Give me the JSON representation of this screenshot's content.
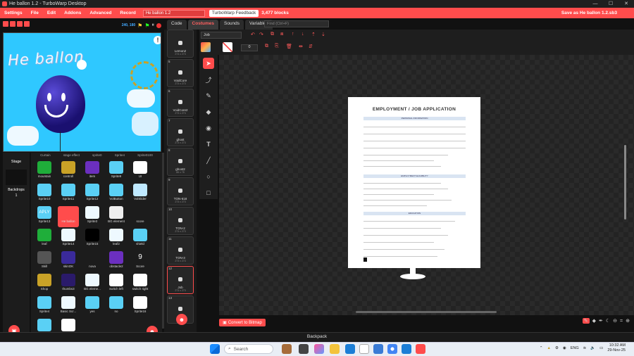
{
  "window": {
    "title": "He ballon 1.2 - TurboWarp Desktop",
    "min": "—",
    "max": "☐",
    "close": "✕"
  },
  "menu": {
    "items": [
      "Settings",
      "File",
      "Edit",
      "Addons",
      "Advanced",
      "Record"
    ],
    "project_title": "He ballon 1.2",
    "feedback": "TurboWarp Feedback",
    "block_count": "3,477 blocks",
    "save_as": "Save as He ballon 1.2.sb3"
  },
  "stage": {
    "fps": "240, 180",
    "canvas_text": "He ballon",
    "pane_label": "Stage",
    "backdrops_label": "Backdrops",
    "backdrops_count": "1"
  },
  "sprites": {
    "cut_row": [
      "Curtain",
      "stage effect",
      "sprite0",
      "Sprite4",
      "Sprite0100"
    ],
    "items": [
      {
        "name": "mountain",
        "color": "#1fae3a"
      },
      {
        "name": "controll",
        "color": "#c9a227"
      },
      {
        "name": "item",
        "color": "#6b2fbf"
      },
      {
        "name": "Sprite9",
        "color": "#5ad0f5"
      },
      {
        "name": "UI",
        "color": "#ffffff"
      },
      {
        "name": "Sprite10",
        "color": "#5ad0f5"
      },
      {
        "name": "Sprite11",
        "color": "#5ad0f5"
      },
      {
        "name": "Sprite12",
        "color": "#5ad0f5"
      },
      {
        "name": "VolButton",
        "color": "#5ad0f5"
      },
      {
        "name": "VolSlider",
        "color": "#bfe9ff"
      },
      {
        "name": "Sprite13",
        "color": "#5ad0f5",
        "badge": "APLY"
      },
      {
        "name": "He ballon",
        "color": "#ff4c4c"
      },
      {
        "name": "Sprite3",
        "color": "#eef9ff"
      },
      {
        "name": "BG element",
        "color": "#eeeeee"
      },
      {
        "name": "score",
        "color": "#1c1c1c"
      },
      {
        "name": "leaf",
        "color": "#1fae3a"
      },
      {
        "name": "Sprite14",
        "color": "#eef9ff"
      },
      {
        "name": "Sprite15",
        "color": "#000000"
      },
      {
        "name": "leaf2",
        "color": "#eef9ff"
      },
      {
        "name": "shield",
        "color": "#5ad0f5"
      },
      {
        "name": "Skill",
        "color": "#555555"
      },
      {
        "name": "skinOK",
        "color": "#3a2a9a"
      },
      {
        "name": "nova",
        "color": "#1c1c1c"
      },
      {
        "name": "obstacle2",
        "color": "#6b2fbf"
      },
      {
        "name": "Score",
        "color": "#1c1c1c",
        "glyph": "9"
      },
      {
        "name": "Shop",
        "color": "#c9a227"
      },
      {
        "name": "thumbs3",
        "color": "#2a1a6a"
      },
      {
        "name": "BG eleme...",
        "color": "#eef9ff"
      },
      {
        "name": "switch left",
        "color": "#ffffff"
      },
      {
        "name": "switch right",
        "color": "#ffffff"
      },
      {
        "name": "Sprite4",
        "color": "#5ad0f5"
      },
      {
        "name": "Basic Scr...",
        "color": "#eef9ff"
      },
      {
        "name": "yes",
        "color": "#5ad0f5"
      },
      {
        "name": "no",
        "color": "#5ad0f5"
      },
      {
        "name": "Sprite16",
        "color": "#ffffff"
      },
      {
        "name": "ok",
        "color": "#5ad0f5"
      },
      {
        "name": "shop lay",
        "color": "#ffffff"
      }
    ]
  },
  "editor": {
    "tabs": [
      "Code",
      "Costumes",
      "Sounds",
      "Variables"
    ],
    "find_placeholder": "Find (Ctrl+F)",
    "costume_name": "Job",
    "size_value": "0",
    "convert_label": "Convert to Bitmap",
    "backpack_label": "Backpack"
  },
  "costumes": [
    {
      "num": "",
      "name": "Lemon2",
      "size": "273 x 273"
    },
    {
      "num": "5",
      "name": "VoidCore",
      "size": "273 x 273"
    },
    {
      "num": "6",
      "name": "VoidCore2",
      "size": "273 x 273"
    },
    {
      "num": "7",
      "name": "ghost",
      "size": "273 x 273"
    },
    {
      "num": "8",
      "name": "ghost2",
      "size": "86 x 78"
    },
    {
      "num": "9",
      "name": "TON-618",
      "size": "273 x 273"
    },
    {
      "num": "10",
      "name": "TON-2",
      "size": "273 x 273"
    },
    {
      "num": "11",
      "name": "TON-3",
      "size": "273 x 273"
    },
    {
      "num": "12",
      "name": "Job",
      "size": "273 x 273"
    },
    {
      "num": "13",
      "name": "job",
      "size": "0 x 0"
    }
  ],
  "document": {
    "title": "EMPLOYMENT / JOB APPLICATION",
    "sec1": "PERSONAL INFORMATION",
    "sec2": "EMPLOYMENT ELIGIBILITY",
    "sec3": "EDUCATION"
  },
  "taskbar": {
    "search": "Search",
    "lang": "ENG",
    "time": "10:32 AM",
    "date": "29-Nov-25"
  },
  "colors": {
    "accent": "#ff4c4c",
    "stage_bg": "#2fc8ff"
  }
}
